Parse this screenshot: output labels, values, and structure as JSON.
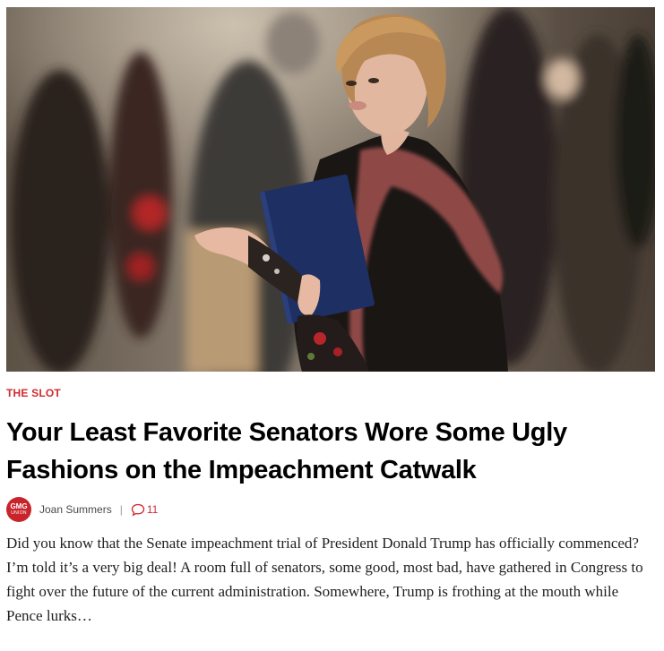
{
  "article": {
    "image_alt": "Senator holding a blue folder in a crowded hallway",
    "category": "THE SLOT",
    "headline": "Your Least Favorite Senators Wore Some Ugly Fashions on the Impeachment Catwalk",
    "author": {
      "avatar_line1": "GMG",
      "avatar_line2": "UNION",
      "name": "Joan Summers"
    },
    "separator": "|",
    "comments_count": "11",
    "excerpt": "Did you know that the Senate impeachment trial of President Donald Trump has officially commenced? I’m told it’s a very big deal! A room full of senators, some good, most bad, have gathered in Congress to fight over the future of the current administration. Somewhere, Trump is frothing at the mouth while Pence lurks…"
  },
  "colors": {
    "accent": "#d1282e",
    "headline": "#000000",
    "body_text": "#222222",
    "avatar_bg": "#c8242b"
  },
  "icons": {
    "comments": "speech-bubble-icon",
    "avatar": "gmg-union-logo-icon"
  }
}
